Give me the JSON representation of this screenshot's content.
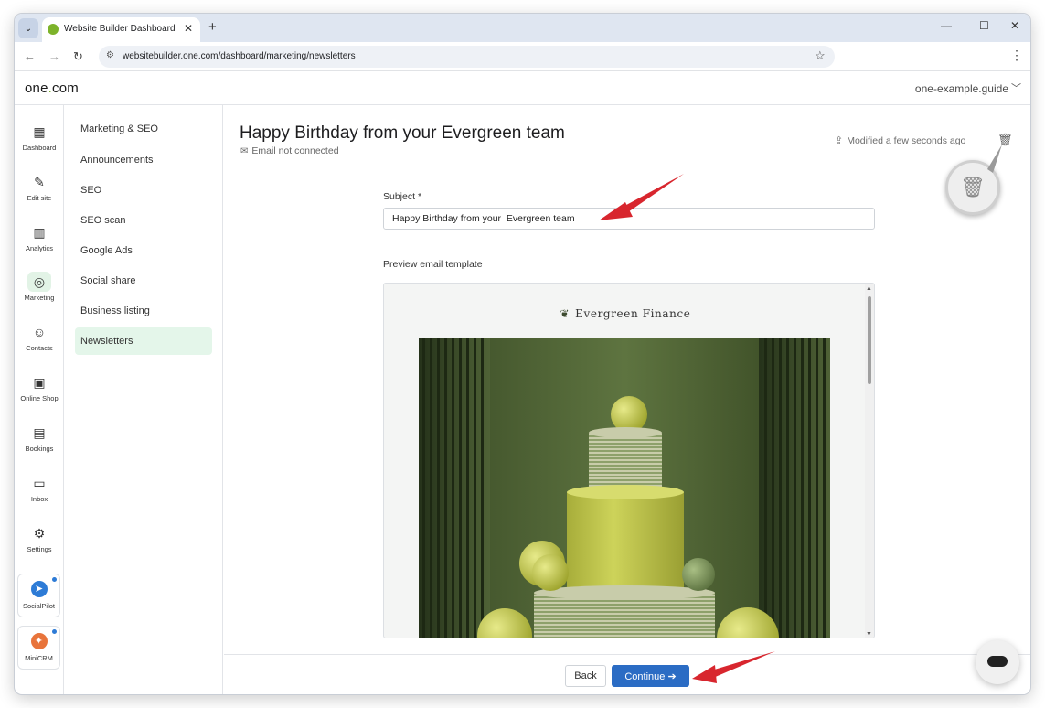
{
  "browser": {
    "tab_title": "Website Builder Dashboard",
    "tab_close": "✕",
    "new_tab": "+",
    "url": "websitebuilder.one.com/dashboard/marketing/newsletters",
    "controls": {
      "minimize": "—",
      "maximize": "☐",
      "close": "✕"
    }
  },
  "header": {
    "logo_left": "one",
    "logo_dot": ".",
    "logo_right": "com",
    "account": "one-example.guide"
  },
  "rail": [
    {
      "label": "Dashboard",
      "icon": "dashboard-icon",
      "glyph": "▦",
      "active": false
    },
    {
      "label": "Edit site",
      "icon": "edit-site-icon",
      "glyph": "✎",
      "active": false
    },
    {
      "label": "Analytics",
      "icon": "analytics-icon",
      "glyph": "▥",
      "active": false
    },
    {
      "label": "Marketing",
      "icon": "marketing-icon",
      "glyph": "◎",
      "active": true
    },
    {
      "label": "Contacts",
      "icon": "contacts-icon",
      "glyph": "☺",
      "active": false
    },
    {
      "label": "Online Shop",
      "icon": "shop-icon",
      "glyph": "▣",
      "active": false
    },
    {
      "label": "Bookings",
      "icon": "calendar-icon",
      "glyph": "▤",
      "active": false
    },
    {
      "label": "Inbox",
      "icon": "inbox-icon",
      "glyph": "▭",
      "active": false
    },
    {
      "label": "Settings",
      "icon": "gear-icon",
      "glyph": "⚙",
      "active": false
    }
  ],
  "extensions": [
    {
      "label": "SocialPilot",
      "icon": "socialpilot-icon",
      "glyph": "➤",
      "color": "#2d7bd6"
    },
    {
      "label": "MiniCRM",
      "icon": "minicrm-icon",
      "glyph": "✦",
      "color": "#e8743b"
    }
  ],
  "subnav": [
    {
      "label": "Marketing & SEO",
      "active": false
    },
    {
      "label": "Announcements",
      "active": false
    },
    {
      "label": "SEO",
      "active": false
    },
    {
      "label": "SEO scan",
      "active": false
    },
    {
      "label": "Google Ads",
      "active": false
    },
    {
      "label": "Social share",
      "active": false
    },
    {
      "label": "Business listing",
      "active": false
    },
    {
      "label": "Newsletters",
      "active": true
    }
  ],
  "main": {
    "title": "Happy Birthday from your Evergreen team",
    "email_status": "Email not connected",
    "modified": "Modified a few seconds ago",
    "subject_label": "Subject *",
    "subject_value": "Happy Birthday from your  Evergreen team",
    "preview_label": "Preview email template",
    "brand_name": "Evergreen Finance",
    "back_label": "Back",
    "continue_label": "Continue"
  },
  "colors": {
    "accent": "#2b6cc4",
    "brand_green": "#7db32a",
    "active_bg": "#e4f6ea",
    "annotation_red": "#d8262e"
  }
}
